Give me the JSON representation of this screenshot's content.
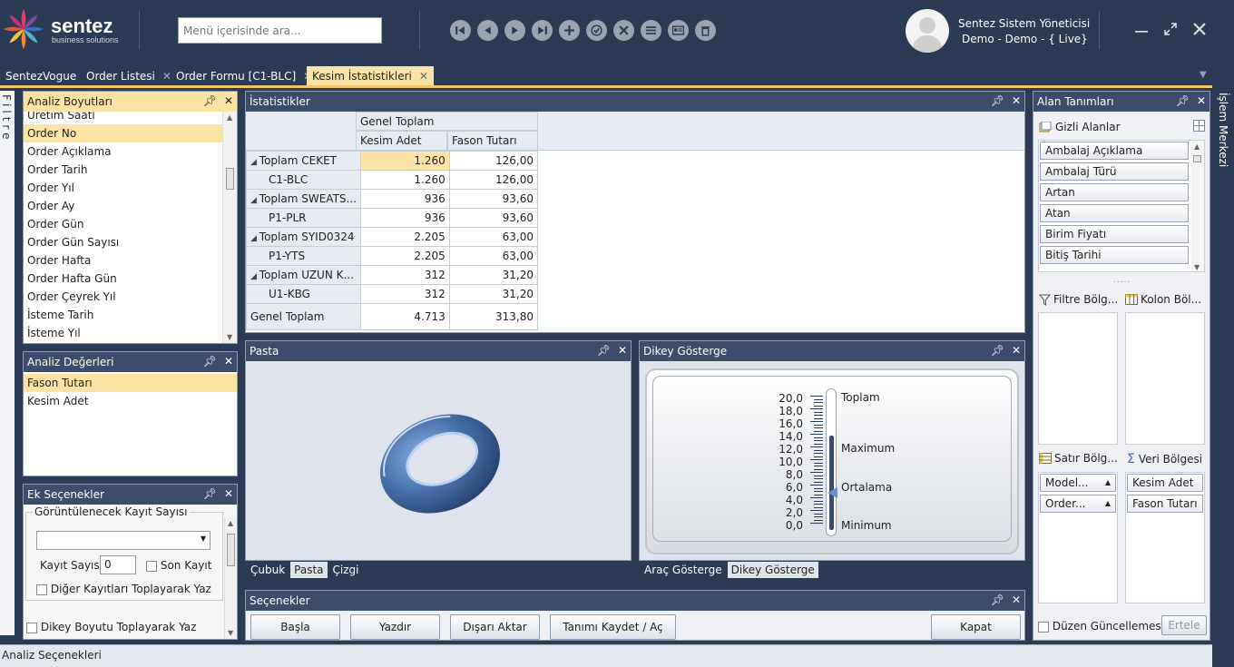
{
  "header": {
    "brand": "sentez",
    "brand_sub": "business solutions",
    "search_placeholder": "Menü içerisinde ara...",
    "user_name": "Sentez Sistem Yöneticisi",
    "user_sub": "Demo - Demo - { Live}",
    "toolbar_icons": [
      "first-icon",
      "prev-icon",
      "play-icon",
      "last-icon",
      "add-icon",
      "check-icon",
      "cancel-icon",
      "list-icon",
      "card-icon",
      "delete-icon"
    ]
  },
  "tabs": [
    {
      "label": "SentezVogue",
      "closable": false
    },
    {
      "label": "Order Listesi",
      "closable": true
    },
    {
      "label": "Order Formu [C1-BLC]",
      "closable": true
    },
    {
      "label": "Kesim İstatistikleri",
      "closable": true,
      "active": true
    }
  ],
  "left_rail": "Filtre",
  "right_rail": "İşlem Merkezi",
  "analiz_boyutlari": {
    "title": "Analiz Boyutları",
    "items": [
      "Üretim Saati",
      "Order No",
      "Order Açıklama",
      "Order Tarih",
      "Order Yıl",
      "Order Ay",
      "Order Gün",
      "Order Gün Sayısı",
      "Order Hafta",
      "Order Hafta Gün",
      "Order Çeyrek Yıl",
      "İsteme Tarih",
      "İsteme Yıl"
    ],
    "selected": "Order No"
  },
  "analiz_degerleri": {
    "title": "Analiz Değerleri",
    "items": [
      "Fason Tutarı",
      "Kesim Adet"
    ],
    "selected": "Fason Tutarı"
  },
  "ek_secenekler": {
    "title": "Ek Seçenekler",
    "group_label": "Görüntülenecek Kayıt Sayısı",
    "kayit_sayisi_label": "Kayıt Sayısı",
    "kayit_sayisi_value": "0",
    "son_kayit_label": "Son Kayıt",
    "diger_label": "Diğer Kayıtları Toplayarak Yaz",
    "dikey_label": "Dikey Boyutu Toplayarak Yaz"
  },
  "istatistikler": {
    "title": "İstatistikler",
    "group_header": "Genel Toplam",
    "columns": [
      "Kesim Adet",
      "Fason Tutarı"
    ],
    "rows": [
      {
        "label": "Toplam CEKET",
        "total": true,
        "kesim": "1.260",
        "fason": "126,00"
      },
      {
        "label": "C1-BLC",
        "total": false,
        "kesim": "1.260",
        "fason": "126,00"
      },
      {
        "label": "Toplam SWEATS...",
        "total": true,
        "kesim": "936",
        "fason": "93,60"
      },
      {
        "label": "P1-PLR",
        "total": false,
        "kesim": "936",
        "fason": "93,60"
      },
      {
        "label": "Toplam SYID0324",
        "total": true,
        "kesim": "2.205",
        "fason": "63,00"
      },
      {
        "label": "P1-YTS",
        "total": false,
        "kesim": "2.205",
        "fason": "63,00"
      },
      {
        "label": "Toplam UZUN K...",
        "total": true,
        "kesim": "312",
        "fason": "31,20"
      },
      {
        "label": "U1-KBG",
        "total": false,
        "kesim": "312",
        "fason": "31,20"
      }
    ],
    "grand_total": {
      "label": "Genel Toplam",
      "kesim": "4.713",
      "fason": "313,80"
    }
  },
  "pasta": {
    "title": "Pasta",
    "subtabs": [
      "Çubuk",
      "Pasta",
      "Çizgi"
    ],
    "active_subtab": "Pasta"
  },
  "dikey_gosterge": {
    "title": "Dikey Gösterge",
    "subtabs": [
      "Araç Gösterge",
      "Dikey Gösterge"
    ],
    "active_subtab": "Dikey Gösterge",
    "scale": [
      "20,0",
      "18,0",
      "16,0",
      "14,0",
      "12,0",
      "10,0",
      "8,0",
      "6,0",
      "4,0",
      "2,0",
      "0,0"
    ],
    "labels": {
      "toplam": "Toplam",
      "maximum": "Maximum",
      "ortalama": "Ortalama",
      "minimum": "Minimum"
    },
    "fill_fraction": 0.72,
    "marker_fraction": 0.27
  },
  "secenekler": {
    "title": "Seçenekler",
    "buttons": [
      "Başla",
      "Yazdır",
      "Dışarı Aktar",
      "Tanımı Kaydet / Aç"
    ],
    "close": "Kapat"
  },
  "alan_tanimlari": {
    "title": "Alan Tanımları",
    "gizli_label": "Gizli Alanlar",
    "gizli_items": [
      "Ambalaj Açıklama",
      "Ambalaj Türü",
      "Artan",
      "Atan",
      "Birim Fiyatı",
      "Bitiş Tarihi"
    ],
    "filtre_label": "Filtre Bölg...",
    "kolon_label": "Kolon Böl...",
    "satir_label": "Satır Bölg...",
    "veri_label": "Veri Bölgesi",
    "satir_items": [
      "Model...",
      "Order..."
    ],
    "veri_items": [
      "Kesim Adet",
      "Fason Tutarı"
    ],
    "duzen_label": "Düzen Güncellemesini",
    "guncelle": "Ertele"
  },
  "status_bar": "Analiz Seçenekleri",
  "colors": {
    "header_bg": "#2b3a55",
    "accent": "#fbe3a6",
    "tab_line": "#f4c56a"
  }
}
